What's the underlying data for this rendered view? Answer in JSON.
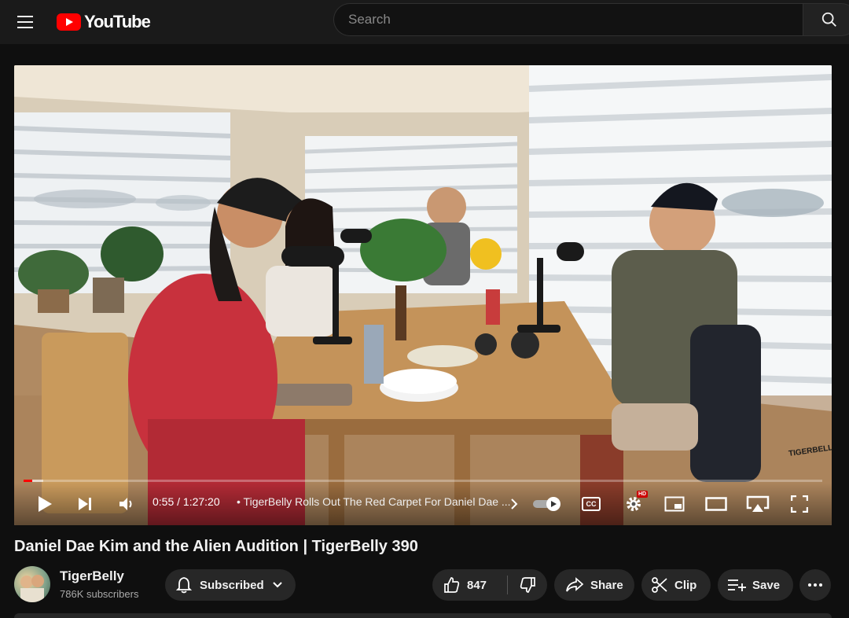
{
  "header": {
    "logo_text": "YouTube",
    "search_placeholder": "Search"
  },
  "player": {
    "time_current": "0:55",
    "time_separator": "/",
    "time_total": "1:27:20",
    "chapter_bullet": "•",
    "chapter_title": "TigerBelly Rolls Out The Red Carpet For Daniel Dae ...",
    "hd_badge": "HD",
    "cc_label": "CC",
    "watermark": "TIGERBELLY",
    "progress_fraction": 0.0105,
    "buffered_fraction": 0.025
  },
  "video": {
    "title": "Daniel Dae Kim and the Alien Audition | TigerBelly 390"
  },
  "channel": {
    "name": "TigerBelly",
    "subscribers": "786K subscribers",
    "subscribed_label": "Subscribed"
  },
  "actions": {
    "like_count": "847",
    "share_label": "Share",
    "clip_label": "Clip",
    "save_label": "Save"
  },
  "colors": {
    "accent": "#ff0000",
    "background": "#0f0f0f",
    "pill": "#272727"
  }
}
